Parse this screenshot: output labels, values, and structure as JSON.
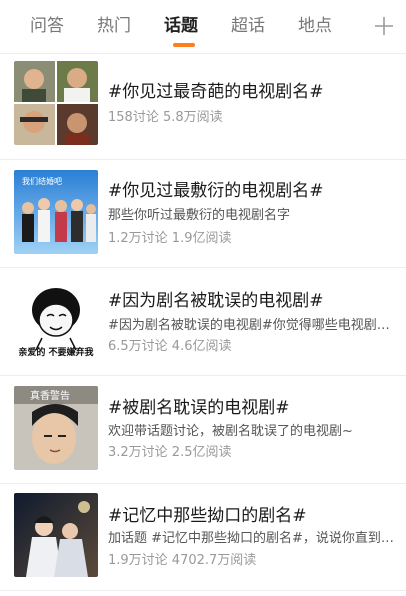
{
  "tabs": [
    {
      "label": "问答"
    },
    {
      "label": "热门"
    },
    {
      "label": "话题"
    },
    {
      "label": "超话"
    },
    {
      "label": "地点"
    }
  ],
  "active_tab": "话题",
  "colors": {
    "accent": "#ff7d1a"
  },
  "topics": [
    {
      "title": "#你见过最奇葩的电视剧名#",
      "desc": "",
      "stats": "158讨论 5.8万阅读"
    },
    {
      "title": "#你见过最敷衍的电视剧名#",
      "desc": "那些你听过最敷衍的电视剧名字",
      "stats": "1.2万讨论 1.9亿阅读",
      "thumb_text": "我们结婚吧"
    },
    {
      "title": "#因为剧名被耽误的电视剧#",
      "desc": "#因为剧名被耽误的电视剧#你觉得哪些电视剧被剧名耽误了",
      "stats": "6.5万讨论 4.6亿阅读",
      "thumb_text": "亲爱的 不要嫌弃我"
    },
    {
      "title": "#被剧名耽误的电视剧#",
      "desc": "欢迎带话题讨论，被剧名耽误了的电视剧~",
      "stats": "3.2万讨论 2.5亿阅读",
      "thumb_text": "真香警告"
    },
    {
      "title": "#记忆中那些拗口的剧名#",
      "desc": "加话题 #记忆中那些拗口的剧名#，说说你直到现在都记不住的剧名吧",
      "stats": "1.9万讨论 4702.7万阅读"
    }
  ]
}
